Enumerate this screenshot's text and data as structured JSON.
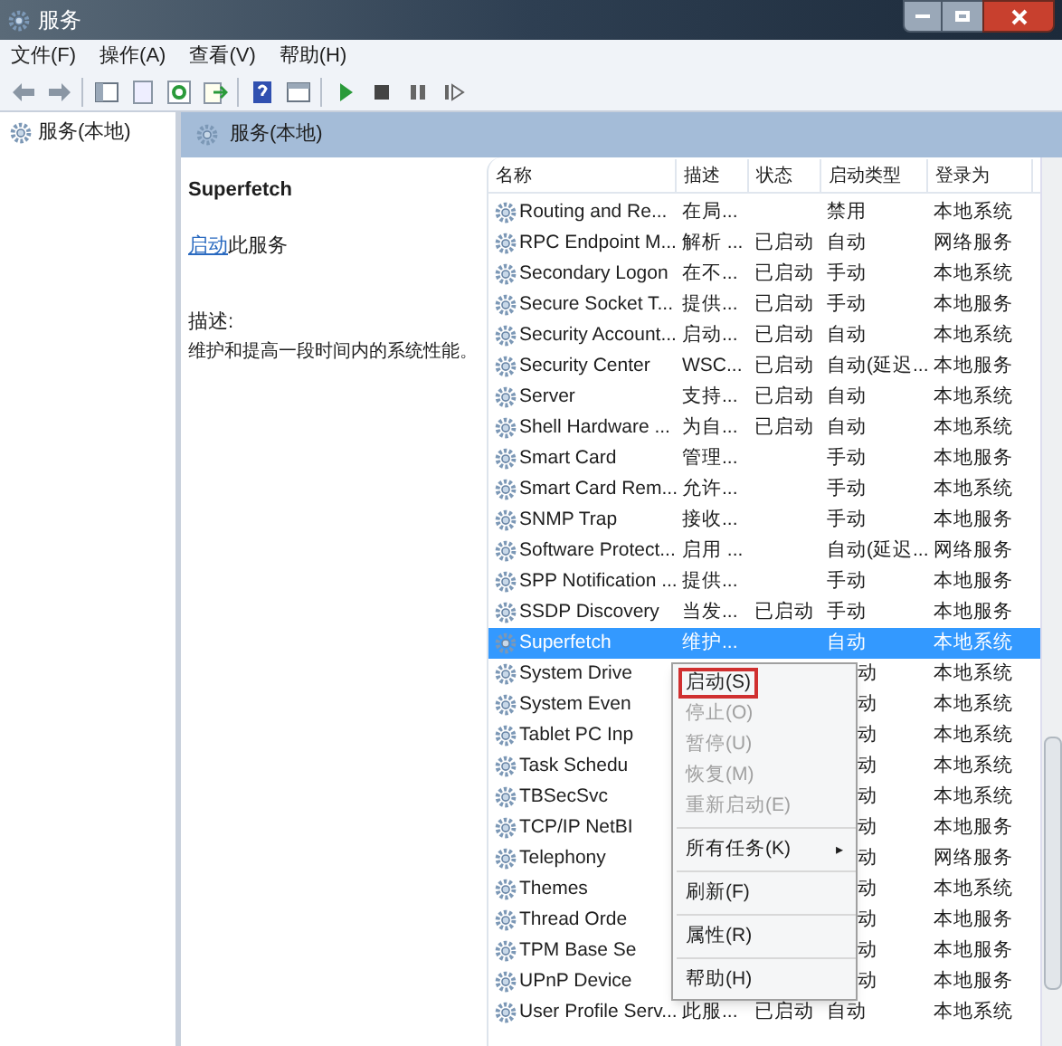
{
  "window": {
    "title": "服务"
  },
  "menu": [
    "文件(F)",
    "操作(A)",
    "查看(V)",
    "帮助(H)"
  ],
  "tree": {
    "items": [
      {
        "label": "服务(本地)",
        "selected": false
      }
    ]
  },
  "panel_title": "服务(本地)",
  "details": {
    "name": "Superfetch",
    "action_link": "启动",
    "action_rest": "此服务",
    "desc_label": "描述:",
    "desc": "维护和提高一段时间内的系统性能。"
  },
  "table": {
    "columns": [
      "名称",
      "描述",
      "状态",
      "启动类型",
      "登录为"
    ],
    "rows": [
      {
        "name": "Routing and Re...",
        "desc": "在局...",
        "status": "",
        "start": "禁用",
        "logon": "本地系统",
        "selected": false
      },
      {
        "name": "RPC Endpoint M...",
        "desc": "解析 ...",
        "status": "已启动",
        "start": "自动",
        "logon": "网络服务",
        "selected": false
      },
      {
        "name": "Secondary Logon",
        "desc": "在不...",
        "status": "已启动",
        "start": "手动",
        "logon": "本地系统",
        "selected": false
      },
      {
        "name": "Secure Socket T...",
        "desc": "提供...",
        "status": "已启动",
        "start": "手动",
        "logon": "本地服务",
        "selected": false
      },
      {
        "name": "Security Account...",
        "desc": "启动...",
        "status": "已启动",
        "start": "自动",
        "logon": "本地系统",
        "selected": false
      },
      {
        "name": "Security Center",
        "desc": "WSC...",
        "status": "已启动",
        "start": "自动(延迟...",
        "logon": "本地服务",
        "selected": false
      },
      {
        "name": "Server",
        "desc": "支持...",
        "status": "已启动",
        "start": "自动",
        "logon": "本地系统",
        "selected": false
      },
      {
        "name": "Shell Hardware ...",
        "desc": "为自...",
        "status": "已启动",
        "start": "自动",
        "logon": "本地系统",
        "selected": false
      },
      {
        "name": "Smart Card",
        "desc": "管理...",
        "status": "",
        "start": "手动",
        "logon": "本地服务",
        "selected": false
      },
      {
        "name": "Smart Card Rem...",
        "desc": "允许...",
        "status": "",
        "start": "手动",
        "logon": "本地系统",
        "selected": false
      },
      {
        "name": "SNMP Trap",
        "desc": "接收...",
        "status": "",
        "start": "手动",
        "logon": "本地服务",
        "selected": false
      },
      {
        "name": "Software Protect...",
        "desc": "启用 ...",
        "status": "",
        "start": "自动(延迟...",
        "logon": "网络服务",
        "selected": false
      },
      {
        "name": "SPP Notification ...",
        "desc": "提供...",
        "status": "",
        "start": "手动",
        "logon": "本地服务",
        "selected": false
      },
      {
        "name": "SSDP Discovery",
        "desc": "当发...",
        "status": "已启动",
        "start": "手动",
        "logon": "本地服务",
        "selected": false
      },
      {
        "name": "Superfetch",
        "desc": "维护...",
        "status": "",
        "start": "自动",
        "logon": "本地系统",
        "selected": true
      },
      {
        "name": "System Drive",
        "start": "动",
        "logon": "本地系统",
        "selected": false
      },
      {
        "name": "System Even",
        "start": "动",
        "logon": "本地系统",
        "selected": false
      },
      {
        "name": "Tablet PC Inp",
        "start": "动",
        "logon": "本地系统",
        "selected": false
      },
      {
        "name": "Task Schedu",
        "start": "动",
        "logon": "本地系统",
        "selected": false
      },
      {
        "name": "TBSecSvc",
        "start": "动",
        "logon": "本地系统",
        "selected": false
      },
      {
        "name": "TCP/IP NetBI",
        "start": "动",
        "logon": "本地服务",
        "selected": false
      },
      {
        "name": "Telephony",
        "start": "动",
        "logon": "网络服务",
        "selected": false
      },
      {
        "name": "Themes",
        "start": "动",
        "logon": "本地系统",
        "selected": false
      },
      {
        "name": "Thread Orde",
        "start": "动",
        "logon": "本地服务",
        "selected": false
      },
      {
        "name": "TPM Base Se",
        "start": "动",
        "logon": "本地服务",
        "selected": false
      },
      {
        "name": "UPnP Device",
        "start": "动",
        "logon": "本地服务",
        "selected": false
      },
      {
        "name": "User Profile Serv...",
        "desc": "此服...",
        "status": "已启动",
        "start": "自动",
        "logon": "本地系统",
        "selected": false
      }
    ]
  },
  "context_menu": [
    {
      "kind": "item",
      "label": "启动(S)",
      "disabled": false,
      "selected": true
    },
    {
      "kind": "item",
      "label": "停止(O)",
      "disabled": true,
      "selected": false
    },
    {
      "kind": "item",
      "label": "暂停(U)",
      "disabled": true,
      "selected": false
    },
    {
      "kind": "item",
      "label": "恢复(M)",
      "disabled": true,
      "selected": false
    },
    {
      "kind": "item",
      "label": "重新启动(E)",
      "disabled": true,
      "selected": false
    },
    {
      "kind": "separator"
    },
    {
      "kind": "submenu",
      "label": "所有任务(K)",
      "arrow": "▸",
      "disabled": false,
      "selected": false
    },
    {
      "kind": "separator"
    },
    {
      "kind": "item",
      "label": "刷新(F)",
      "disabled": false,
      "selected": false
    },
    {
      "kind": "separator"
    },
    {
      "kind": "item",
      "label": "属性(R)",
      "disabled": false,
      "selected": false
    },
    {
      "kind": "separator"
    },
    {
      "kind": "item",
      "label": "帮助(H)",
      "disabled": false,
      "selected": false
    }
  ]
}
